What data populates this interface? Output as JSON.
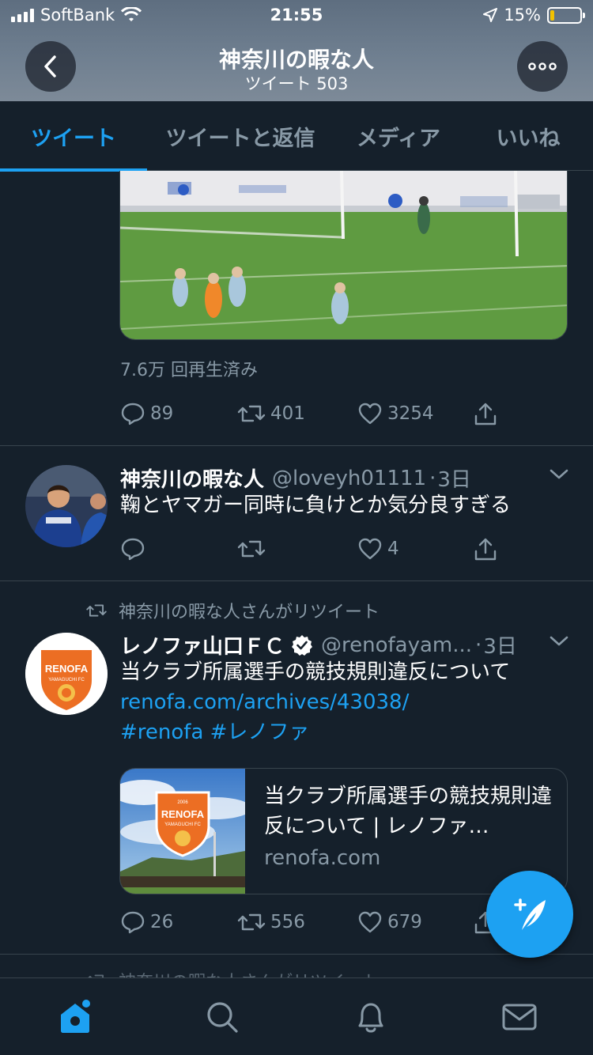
{
  "status_bar": {
    "carrier": "SoftBank",
    "time": "21:55",
    "battery": "15%",
    "battery_level": 0.15
  },
  "header": {
    "title": "神奈川の暇な人",
    "subtitle": "ツイート 503"
  },
  "tabs": [
    {
      "label": "ツイート",
      "active": true
    },
    {
      "label": "ツイートと返信",
      "active": false
    },
    {
      "label": "メディア",
      "active": false
    },
    {
      "label": "いいね",
      "active": false
    }
  ],
  "tweets": [
    {
      "media_views": "7.6万 回再生済み",
      "replies": "89",
      "retweets": "401",
      "likes": "3254"
    },
    {
      "name": "神奈川の暇な人",
      "handle": "@loveyh01111",
      "time": "3日",
      "text": "鞠とヤマガー同時に負けとか気分良すぎる",
      "replies": "",
      "retweets": "",
      "likes": "4"
    },
    {
      "retweeted_by": "神奈川の暇な人さんがリツイート",
      "name": "レノファ山口ＦＣ",
      "verified": true,
      "handle": "@renofayam...",
      "time": "3日",
      "text": "当クラブ所属選手の競技規則違反について",
      "link": "renofa.com/archives/43038/",
      "hashtags": "#renofa #レノファ",
      "card": {
        "title": "当クラブ所属選手の競技規則違反について | レノファ…",
        "domain": "renofa.com",
        "logo_text": "RENOFA",
        "logo_sub": "YAMAGUCHI FC",
        "logo_year": "2006"
      },
      "replies": "26",
      "retweets": "556",
      "likes": "679"
    }
  ],
  "partial_next": "神奈川の暇な人さんがリツイート",
  "colors": {
    "background": "#15202b",
    "accent": "#1da1f2",
    "muted": "#8899a6",
    "divider": "#38444d",
    "renofa_orange": "#ec6e23"
  },
  "nav": [
    "home-icon",
    "search-icon",
    "bell-icon",
    "mail-icon"
  ]
}
